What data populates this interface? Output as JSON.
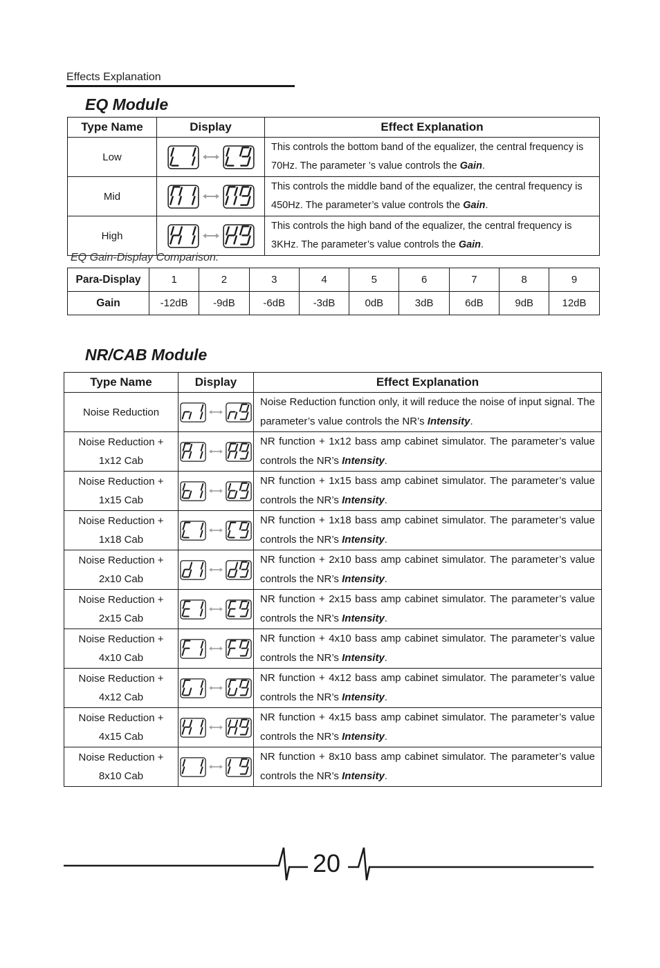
{
  "header": {
    "title": "Effects Explanation"
  },
  "eq_module": {
    "title": "EQ Module",
    "columns": [
      "Type Name",
      "Display",
      "Effect Explanation"
    ],
    "rows": [
      {
        "name": "Low",
        "display_from": "L1",
        "display_to": "L9",
        "text_before": "This controls the bottom band of the equalizer, the central frequency is 70Hz. The parameter  ’s value controls the ",
        "emphasis": "Gain",
        "text_after": "."
      },
      {
        "name": "Mid",
        "display_from": "M1",
        "display_to": "M9",
        "text_before": "This controls the middle band of the equalizer, the central frequency is 450Hz. The parameter’s value controls the ",
        "emphasis": "Gain",
        "text_after": "."
      },
      {
        "name": "High",
        "display_from": "H1",
        "display_to": "H9",
        "text_before": "This controls the high band of the equalizer, the central frequency is 3KHz.  The parameter’s value controls the ",
        "emphasis": "Gain",
        "text_after": "."
      }
    ]
  },
  "gain_comparison": {
    "caption": "EQ Gain-Display Comparison:",
    "row_labels": [
      "Para-Display",
      "Gain"
    ],
    "para_display": [
      "1",
      "2",
      "3",
      "4",
      "5",
      "6",
      "7",
      "8",
      "9"
    ],
    "gain": [
      "-12dB",
      "-9dB",
      "-6dB",
      "-3dB",
      "0dB",
      "3dB",
      "6dB",
      "9dB",
      "12dB"
    ]
  },
  "nr_cab_module": {
    "title": "NR/CAB Module",
    "columns": [
      "Type Name",
      "Display",
      "Effect Explanation"
    ],
    "rows": [
      {
        "name_line1": "Noise Reduction",
        "name_line2": "",
        "display_from": "n1",
        "display_to": "n9",
        "text_before": "Noise Reduction function only, it will reduce the noise of input signal. The parameter’s value controls the NR’s ",
        "emphasis": "Intensity",
        "text_after": "."
      },
      {
        "name_line1": "Noise Reduction +",
        "name_line2": "1x12 Cab",
        "display_from": "A1",
        "display_to": "A9",
        "text_before": "NR function + 1x12 bass amp cabinet simulator. The parameter’s value controls the NR’s ",
        "emphasis": "Intensity",
        "text_after": "."
      },
      {
        "name_line1": "Noise Reduction +",
        "name_line2": "1x15 Cab",
        "display_from": "b1",
        "display_to": "b9",
        "text_before": "NR function + 1x15 bass amp cabinet simulator. The parameter’s value controls the NR’s ",
        "emphasis": "Intensity",
        "text_after": "."
      },
      {
        "name_line1": "Noise Reduction +",
        "name_line2": "1x18 Cab",
        "display_from": "C1",
        "display_to": "C9",
        "text_before": "NR function + 1x18 bass amp cabinet simulator. The parameter’s value controls the NR’s ",
        "emphasis": "Intensity",
        "text_after": "."
      },
      {
        "name_line1": "Noise Reduction +",
        "name_line2": "2x10 Cab",
        "display_from": "d1",
        "display_to": "d9",
        "text_before": "NR function + 2x10 bass amp cabinet simulator. The parameter’s value controls the NR’s ",
        "emphasis": "Intensity",
        "text_after": "."
      },
      {
        "name_line1": "Noise Reduction +",
        "name_line2": "2x15 Cab",
        "display_from": "E1",
        "display_to": "E9",
        "text_before": "NR function + 2x15 bass amp cabinet simulator. The parameter’s value controls the NR’s ",
        "emphasis": "Intensity",
        "text_after": "."
      },
      {
        "name_line1": "Noise Reduction +",
        "name_line2": "4x10 Cab",
        "display_from": "F1",
        "display_to": "F9",
        "text_before": "NR function + 4x10 bass amp cabinet simulator. The parameter’s value controls the NR’s ",
        "emphasis": "Intensity",
        "text_after": "."
      },
      {
        "name_line1": "Noise Reduction +",
        "name_line2": "4x12 Cab",
        "display_from": "G1",
        "display_to": "G9",
        "text_before": "NR function + 4x12 bass amp cabinet simulator. The parameter’s value controls the NR’s ",
        "emphasis": "Intensity",
        "text_after": "."
      },
      {
        "name_line1": "Noise Reduction +",
        "name_line2": "4x15 Cab",
        "display_from": "H1",
        "display_to": "H9",
        "text_before": "NR function + 4x15 bass amp cabinet simulator. The parameter’s value controls the NR’s ",
        "emphasis": "Intensity",
        "text_after": "."
      },
      {
        "name_line1": "Noise Reduction +",
        "name_line2": "8x10 Cab",
        "display_from": "I1",
        "display_to": "I9",
        "text_before": "NR function + 8x10 bass amp cabinet simulator. The parameter’s value controls the NR’s ",
        "emphasis": "Intensity",
        "text_after": "."
      }
    ]
  },
  "footer": {
    "page_number": "20"
  },
  "icons": {
    "display_arrow": "double-arrow-icon",
    "segment_display": "seven-segment-display-icon"
  },
  "colors": {
    "text": "#1a1a1a",
    "arrow": "#a0a0a0",
    "border": "#1a1a1a"
  }
}
